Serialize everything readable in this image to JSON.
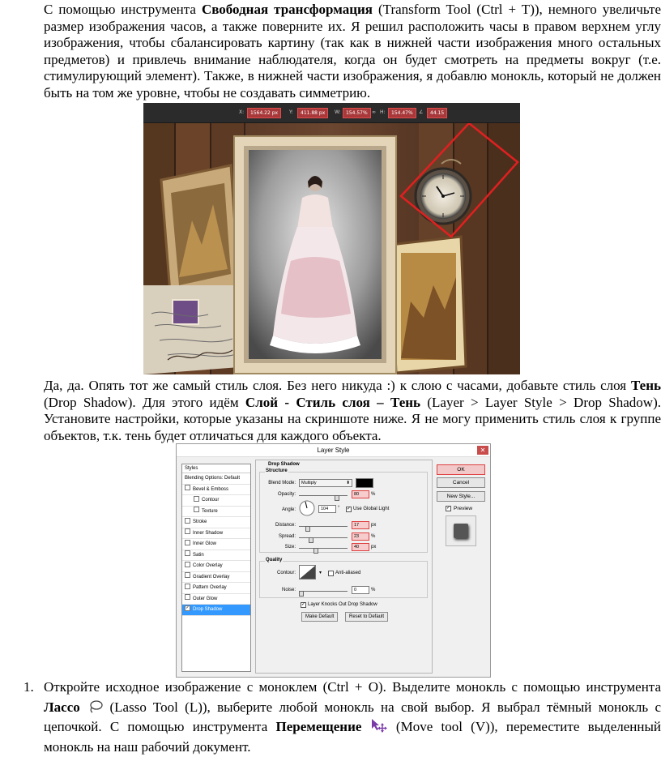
{
  "p1": {
    "a": "С помощью инструмента ",
    "b": "Свободная трансформация",
    "c": " (Transform Tool (Ctrl + T)), немного увеличьте размер изображения часов, а также поверните их. Я решил расположить часы в правом верхнем углу изображения, чтобы сбалансировать картину (так как в нижней части изображения много остальных предметов) и привлечь внимание наблюдателя, когда он будет смотреть на предметы вокруг (т.е. стимулирующий элемент). Также, в нижней части изображения, я добавлю монокль, который не должен быть на том же уровне, чтобы не создавать симметрию."
  },
  "toolbar": {
    "x_label": "X:",
    "x": "1564.22 px",
    "y_label": "Y:",
    "y": "411.88 px",
    "w_label": "W:",
    "w": "154.57%",
    "h_label": "H:",
    "h": "154.47%",
    "rot": "44.15"
  },
  "colors": {
    "highlight": "#e02020",
    "wood": "#5a3a26",
    "accent_red": "#c94c4c"
  },
  "p2": {
    "a": "Да, да. Опять тот же самый стиль слоя. Без него никуда :) к слою с часами, добавьте стиль слоя ",
    "b": "Тень",
    "c": " (Drop Shadow). Для этого идём ",
    "d": "Слой - Стиль слоя – Тень",
    "e": " (Layer > Layer Style > Drop Shadow). Установите настройки, которые указаны на скриншоте ниже. Я не могу применить стиль слоя к группе объектов, т.к. тень будет отличаться для каждого объекта."
  },
  "dialog": {
    "title": "Layer Style",
    "styles_header": "Styles",
    "styles": [
      "Blending Options: Default",
      "Bevel & Emboss",
      "Contour",
      "Texture",
      "Stroke",
      "Inner Shadow",
      "Inner Glow",
      "Satin",
      "Color Overlay",
      "Gradient Overlay",
      "Pattern Overlay",
      "Outer Glow",
      "Drop Shadow"
    ],
    "section": "Drop Shadow",
    "structure": "Structure",
    "blend_mode_label": "Blend Mode:",
    "blend_mode": "Multiply",
    "opacity_label": "Opacity:",
    "opacity": "80",
    "angle_label": "Angle:",
    "angle": "104",
    "global_light": "Use Global Light",
    "distance_label": "Distance:",
    "distance": "17",
    "spread_label": "Spread:",
    "spread": "23",
    "size_label": "Size:",
    "size": "40",
    "pct": "%",
    "px": "px",
    "deg": "°",
    "quality": "Quality",
    "contour_label": "Contour:",
    "anti_aliased": "Anti-aliased",
    "noise_label": "Noise:",
    "noise": "0",
    "knocks_out": "Layer Knocks Out Drop Shadow",
    "make_default": "Make Default",
    "reset_default": "Reset to Default",
    "ok": "OK",
    "cancel": "Cancel",
    "new_style": "New Style...",
    "preview": "Preview",
    "check": "✓",
    "close": "✕"
  },
  "p3": {
    "num": "1.",
    "a": "Откройте исходное изображение с моноклем (Ctrl + O). Выделите монокль с помощью инструмента ",
    "b": "Лассо",
    "c": " (Lasso Tool (L)), выберите любой монокль на свой выбор. Я выбрал тёмный монокль с цепочкой. С помощью инструмента ",
    "d": "Перемещение",
    "e": " (Move tool (V)), переместите выделенный монокль на наш рабочий документ."
  }
}
